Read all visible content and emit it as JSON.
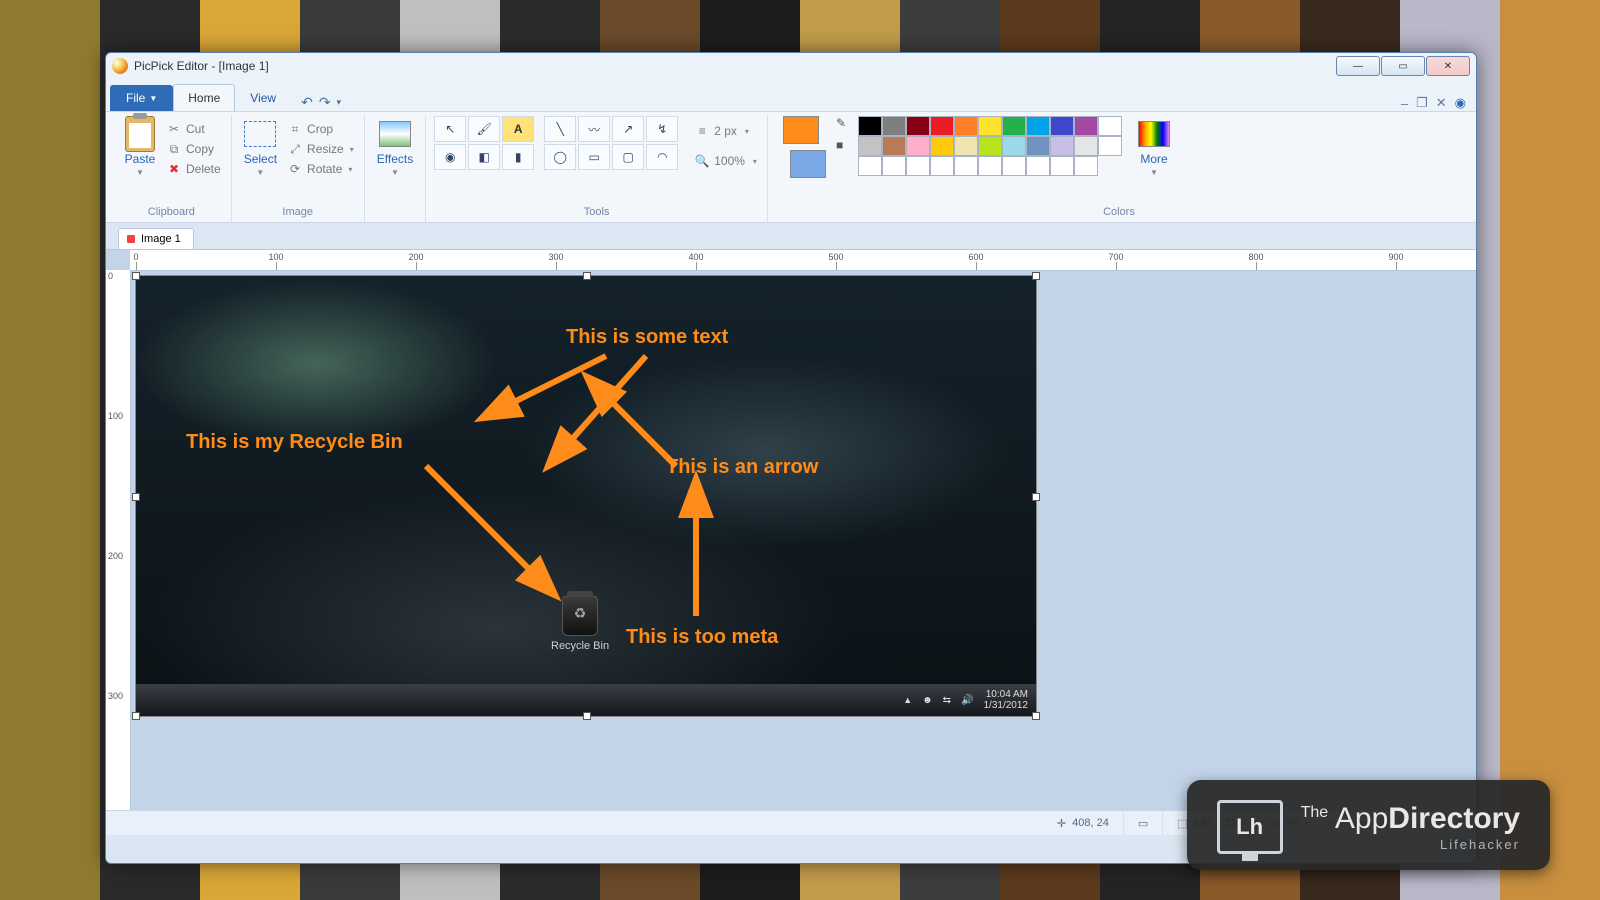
{
  "window": {
    "title": "PicPick Editor - [Image 1]"
  },
  "ribbon": {
    "file_label": "File",
    "tabs": {
      "home": "Home",
      "view": "View"
    },
    "groups": {
      "clipboard": {
        "label": "Clipboard",
        "paste": "Paste",
        "cut": "Cut",
        "copy": "Copy",
        "delete": "Delete"
      },
      "image": {
        "label": "Image",
        "select": "Select",
        "crop": "Crop",
        "resize": "Resize",
        "rotate": "Rotate"
      },
      "effects": {
        "label": "Effects",
        "effects": "Effects"
      },
      "tools": {
        "label": "Tools",
        "stroke": "2 px",
        "zoom": "100%"
      },
      "colors": {
        "label": "Colors",
        "more": "More",
        "current_fg": "#ff8c1a",
        "current_bg": "#7aa8e6",
        "palette": [
          "#000000",
          "#7f7f7f",
          "#880015",
          "#ed1c24",
          "#ff7f27",
          "#ffe22a",
          "#22b14c",
          "#00a2e8",
          "#3f48cc",
          "#a349a4",
          "#ffffff",
          "#c3c3c3",
          "#b97a57",
          "#ffaec9",
          "#ffc90e",
          "#efe4b0",
          "#b5e61d",
          "#99d9ea",
          "#7092be",
          "#c8bfe7",
          "#e5e5e5",
          "#ffffff",
          "#ffffff",
          "#ffffff",
          "#ffffff",
          "#ffffff",
          "#ffffff",
          "#ffffff",
          "#ffffff",
          "#ffffff",
          "#ffffff",
          "#ffffff"
        ]
      }
    }
  },
  "document": {
    "tab_label": "Image 1"
  },
  "ruler": {
    "ticks": [
      "0",
      "100",
      "200",
      "300",
      "400",
      "500",
      "600",
      "700",
      "800",
      "900"
    ]
  },
  "ruler_v": {
    "ticks": [
      "0",
      "100",
      "200",
      "300"
    ]
  },
  "annotations": {
    "text1": "This is some text",
    "text2": "This is my Recycle Bin",
    "text3": "This is an arrow",
    "text4": "This is too meta"
  },
  "recycle": {
    "label": "Recycle Bin"
  },
  "tray": {
    "time": "10:04 AM",
    "date": "1/31/2012"
  },
  "status": {
    "pos": "408, 24",
    "size": "642 x 316",
    "zoom": "100%"
  },
  "branding": {
    "the": "The",
    "app": "App",
    "dir": "Directory",
    "sub": "Lifehacker",
    "monitor": "Lh"
  }
}
